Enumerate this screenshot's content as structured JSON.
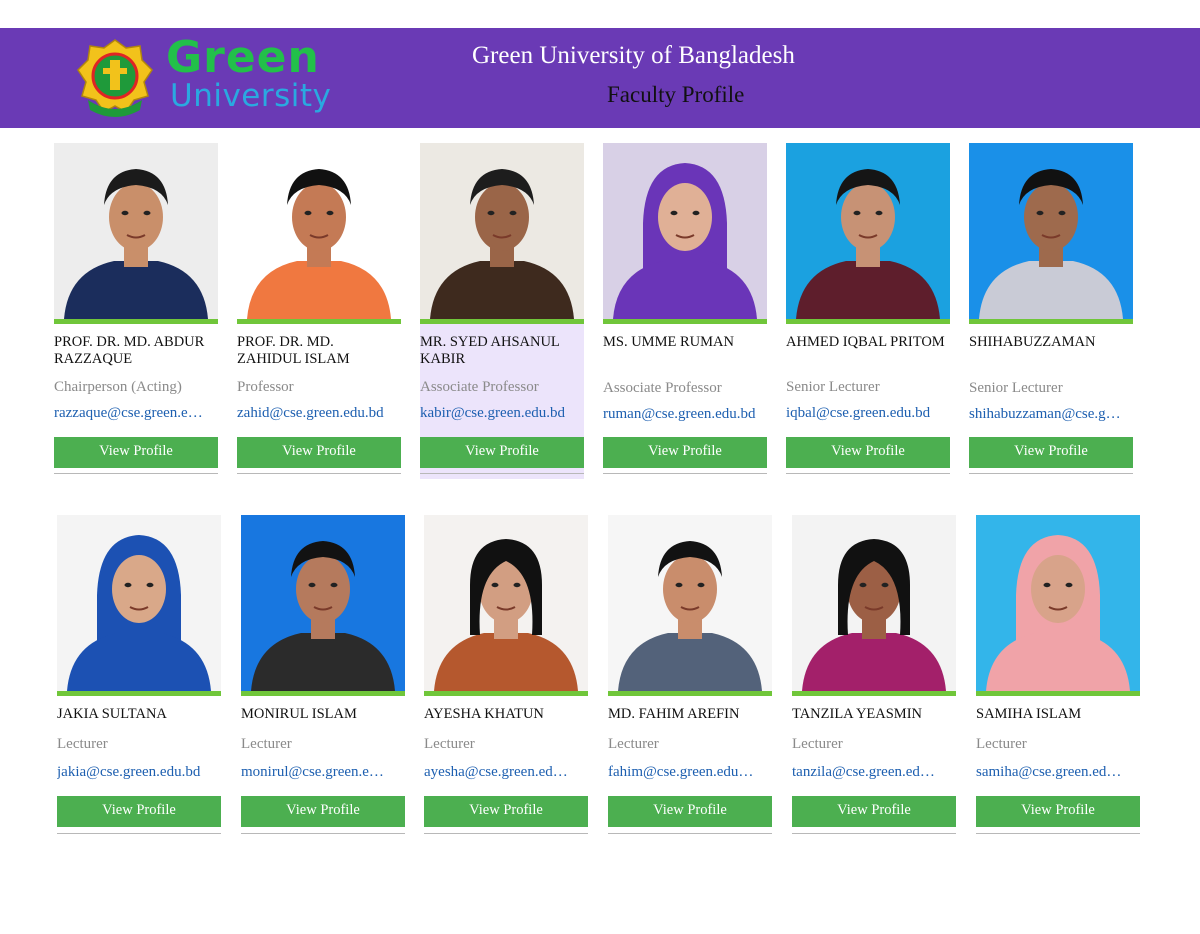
{
  "header": {
    "logo_word1": "Green",
    "logo_word2": "University",
    "logo_seal_text": "Green University",
    "title": "Green University of Bangladesh",
    "subtitle": "Faculty Profile"
  },
  "colors": {
    "header_bg": "#6a3ab5",
    "button": "#4caf50",
    "accent_bar": "#70c63a",
    "link": "#1d5fb0"
  },
  "faculty": [
    {
      "name": "PROF. DR. MD. ABDUR RAZZAQUE",
      "role": "Chairperson (Acting)",
      "email": "razzaque@cse.green.e…",
      "button": "View Profile"
    },
    {
      "name": "PROF. DR. MD. ZAHIDUL ISLAM",
      "role": "Professor",
      "email": "zahid@cse.green.edu.bd",
      "button": "View Profile"
    },
    {
      "name": "MR. SYED AHSANUL KABIR",
      "role": "Associate Professor",
      "email": "kabir@cse.green.edu.bd",
      "button": "View Profile"
    },
    {
      "name": "MS. UMME RUMAN",
      "role": "Associate Professor",
      "email": "ruman@cse.green.edu.bd",
      "button": "View Profile"
    },
    {
      "name": "AHMED IQBAL PRITOM",
      "role": "Senior Lecturer",
      "email": "iqbal@cse.green.edu.bd",
      "button": "View Profile"
    },
    {
      "name": "SHIHABUZZAMAN",
      "role": "Senior Lecturer",
      "email": "shihabuzzaman@cse.g…",
      "button": "View Profile"
    },
    {
      "name": "JAKIA SULTANA",
      "role": "Lecturer",
      "email": "jakia@cse.green.edu.bd",
      "button": "View Profile"
    },
    {
      "name": "MONIRUL ISLAM",
      "role": "Lecturer",
      "email": "monirul@cse.green.e…",
      "button": "View Profile"
    },
    {
      "name": "AYESHA KHATUN",
      "role": "Lecturer",
      "email": "ayesha@cse.green.ed…",
      "button": "View Profile"
    },
    {
      "name": "MD. FAHIM AREFIN",
      "role": "Lecturer",
      "email": "fahim@cse.green.edu…",
      "button": "View Profile"
    },
    {
      "name": "TANZILA YEASMIN",
      "role": "Lecturer",
      "email": "tanzila@cse.green.ed…",
      "button": "View Profile"
    },
    {
      "name": "SAMIHA ISLAM",
      "role": "Lecturer",
      "email": "samiha@cse.green.ed…",
      "button": "View Profile"
    }
  ]
}
